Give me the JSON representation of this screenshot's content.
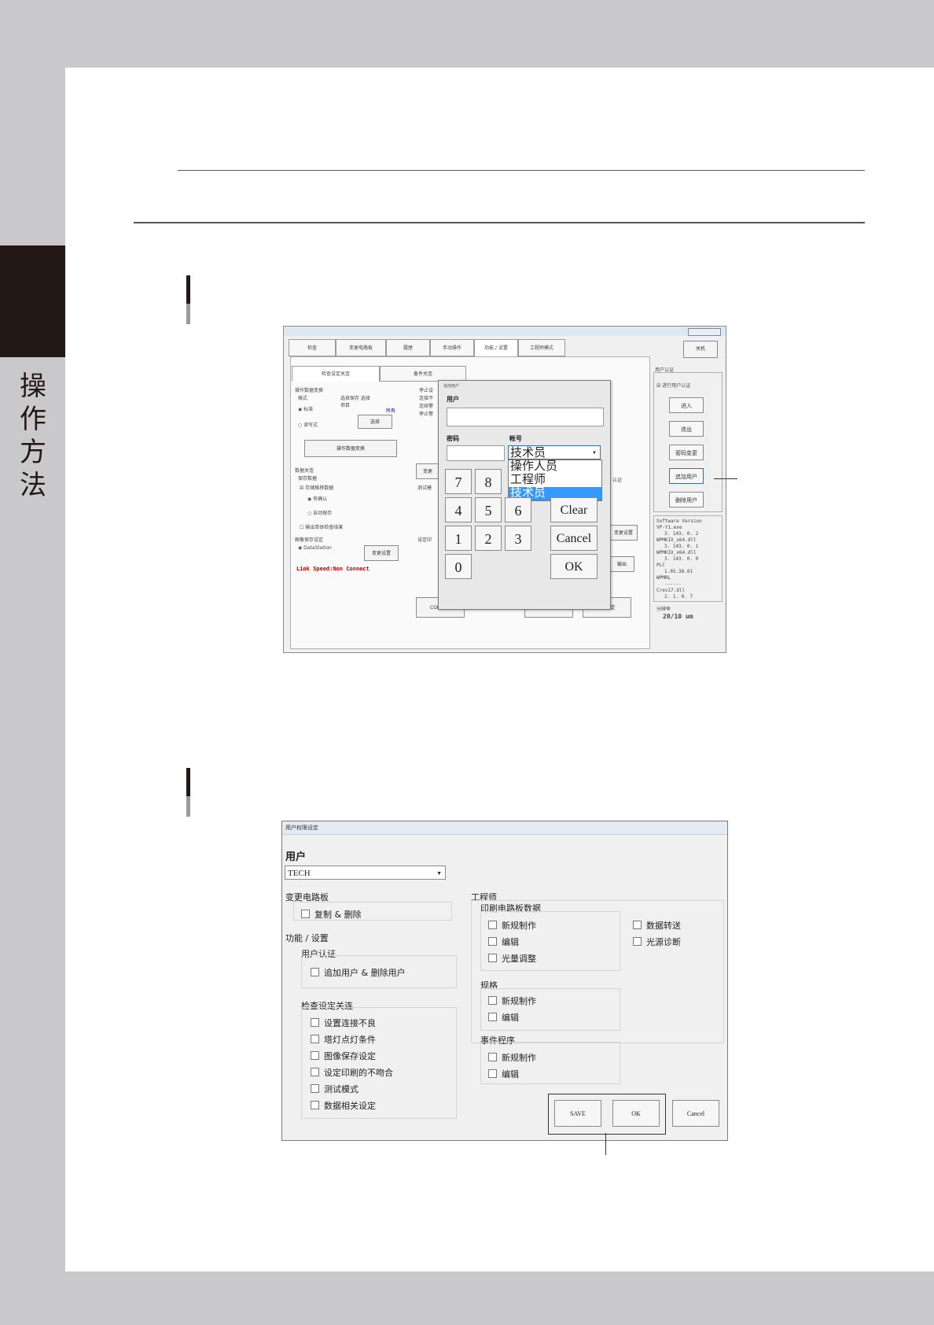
{
  "side_tab": {
    "label_chars": [
      "操",
      "作",
      "方",
      "法"
    ]
  },
  "screen1": {
    "title": "…",
    "tabs": [
      "检查",
      "变更电路板",
      "履歴",
      "手动操作",
      "功能 / 设置",
      "工程师模式"
    ],
    "close_button": "关机",
    "left_tab": "检查设定关连",
    "left_tab2": "备件关连",
    "group_format": "操作数据变换",
    "format_label": "格式",
    "format_options": [
      "标准",
      "读写式"
    ],
    "select_label": "选择保存 选择项目",
    "select_sub": "所有",
    "select_button": "选择",
    "convert_button": "操作数据变换",
    "data_group": "数据关连",
    "save_data": "保存数据",
    "check_save": "存储推移数据",
    "radio_confirm": "有确认",
    "radio_auto": "自动保存",
    "check_output": "输出单体检查结果",
    "image_save": "图像保存设定",
    "radio_datastation": "DataStation",
    "change_setting": "变更设置",
    "link_speed": "Link Speed:Non Connect",
    "stop_labels": [
      "停止设",
      "连接不",
      "连续警",
      "停止警"
    ],
    "mid_labels": [
      "变更",
      "测试模",
      "设定印"
    ],
    "com_button": "COM设定",
    "fb_button": "FB 设定",
    "ff_button": "FF 设定",
    "output_button": "输出",
    "change_set_button": "变更设置",
    "auth_label": "认证",
    "user_auth_group": "用户认证",
    "user_auth_check": "进行用户认证",
    "right_buttons": [
      "进入",
      "退出",
      "密码变更",
      "追加用户",
      "删除用户"
    ],
    "version_title": "Software Version",
    "version_lines": [
      "VP-Y1.exe",
      "3. 143. 0. 2",
      "WPMKIX_x64.dll",
      "3. 143. 0. 1",
      "WPMKIX_x64.dll",
      "3. 143. 0. 0",
      "PLC",
      "1.05.38.01",
      "WPMRL",
      "------",
      "Crev17.dll",
      "2. 1. 0. 7"
    ],
    "resolution_label": "分辨率",
    "resolution_value": "20/10 um"
  },
  "add_user_dialog": {
    "title": "追加用户",
    "user_label": "用户",
    "password_label": "密码",
    "account_label": "帐号",
    "account_selected": "技术员",
    "account_options": [
      "操作人员",
      "工程师",
      "技术员"
    ],
    "keys": {
      "k7": "7",
      "k8": "8",
      "k4": "4",
      "k5": "5",
      "k6": "6",
      "k1": "1",
      "k2": "2",
      "k3": "3",
      "k0": "0",
      "clear": "Clear",
      "cancel": "Cancel",
      "ok": "OK"
    }
  },
  "screen2": {
    "title": "用户权限设定",
    "user_label": "用户",
    "user_selected": "TECH",
    "change_board": "变更电路板",
    "copy_delete": "复制 & 删除",
    "func_setting": "功能 / 设置",
    "user_auth": "用户认证",
    "add_delete_user": "追加用户 & 删除用户",
    "inspect_group": "检查设定关连",
    "inspect_items": [
      "设置连接不良",
      "塔灯点灯条件",
      "图像保存设定",
      "设定印刷的不吻合",
      "测试模式",
      "数据相关设定"
    ],
    "engineer": "工程师",
    "print_board_data": "印刷电路板数据",
    "print_items": [
      "新规制作",
      "编辑",
      "光量调整"
    ],
    "spec": "规格",
    "spec_items": [
      "新规制作",
      "编辑"
    ],
    "event_program": "事件程序",
    "event_items": [
      "新规制作",
      "编辑"
    ],
    "right_items": [
      "数据转送",
      "光源诊断"
    ],
    "save_button": "SAVE",
    "ok_button": "OK",
    "cancel_button": "Cancel"
  }
}
